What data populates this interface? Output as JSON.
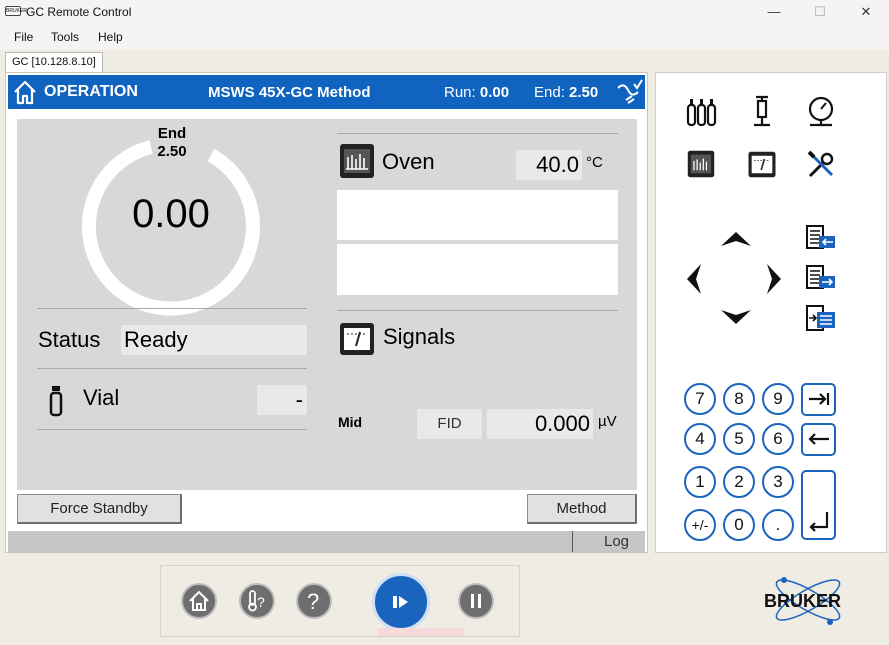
{
  "window": {
    "title": "GC Remote Control",
    "logo_text": "BRUKER",
    "controls": [
      "—",
      "☐",
      "✕"
    ]
  },
  "menu": [
    "File",
    "Tools",
    "Help"
  ],
  "tab": "GC [10.128.8.10]",
  "header": {
    "section": "OPERATION",
    "method": "MSWS 45X-GC Method",
    "run_label": "Run:",
    "run_value": "0.00",
    "end_label": "End:",
    "end_value": "2.50"
  },
  "timer": {
    "end_label": "End",
    "end_value": "2.50",
    "current": "0.00",
    "progress": 0
  },
  "status": {
    "label": "Status",
    "value": "Ready"
  },
  "vial": {
    "label": "Vial",
    "value": "-"
  },
  "oven": {
    "label": "Oven",
    "temperature": "40.0",
    "unit": "°C"
  },
  "signals": {
    "label": "Signals",
    "channel": "Mid",
    "detector": "FID",
    "value": "0.000",
    "unit": "µV"
  },
  "buttons": {
    "force_standby": "Force Standby",
    "method": "Method"
  },
  "statusbar": {
    "log": "Log"
  },
  "keypad": {
    "rows": [
      [
        "7",
        "8",
        "9"
      ],
      [
        "4",
        "5",
        "6"
      ],
      [
        "1",
        "2",
        "3"
      ],
      [
        "+/-",
        "0",
        "."
      ]
    ]
  },
  "brand": {
    "name": "BRUKER"
  },
  "colors": {
    "accent": "#1064bf",
    "keypad_border": "#1a64be",
    "panel_gray": "#d8d8d8"
  }
}
